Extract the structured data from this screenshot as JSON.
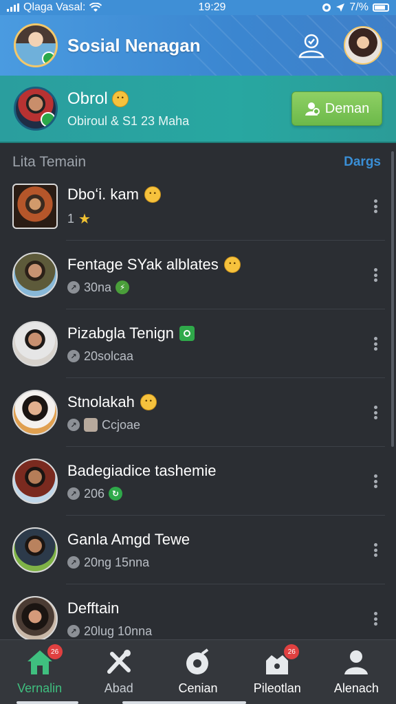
{
  "status_bar": {
    "carrier": "Qlaga Vasal:",
    "time": "19:29",
    "battery": "7/%"
  },
  "header": {
    "title": "Sosial Nenagan"
  },
  "banner": {
    "name": "Obrol",
    "subtitle": "Obiroul & S1 23 Maha",
    "button_label": "Deman"
  },
  "list": {
    "title": "Lita Temain",
    "action": "Dargs"
  },
  "friends": [
    {
      "name": "Dboʻi. kam",
      "status": "1"
    },
    {
      "name": "Fentage SYak alblates",
      "status": "30na"
    },
    {
      "name": "Pizabgla Tenign",
      "status": "20solcaa"
    },
    {
      "name": "Stnolakah",
      "status": "Ccjoae"
    },
    {
      "name": "Badegiadice tashemie",
      "status": "206"
    },
    {
      "name": "Ganla Amgd Tewe",
      "status": "20ng 15nna"
    },
    {
      "name": "Defftain",
      "status": "20lug 10nna"
    }
  ],
  "nav": [
    {
      "label": "Vernalin",
      "badge": "26"
    },
    {
      "label": "Abad"
    },
    {
      "label": "Cenian"
    },
    {
      "label": "Pileotlan",
      "badge": "26"
    },
    {
      "label": "Alenach"
    }
  ],
  "colors": {
    "header": "#3f8fd6",
    "banner": "#28a7a1",
    "accent_green": "#6cb94a",
    "list_bg": "#2b2e33",
    "link_blue": "#3a8fd6"
  }
}
